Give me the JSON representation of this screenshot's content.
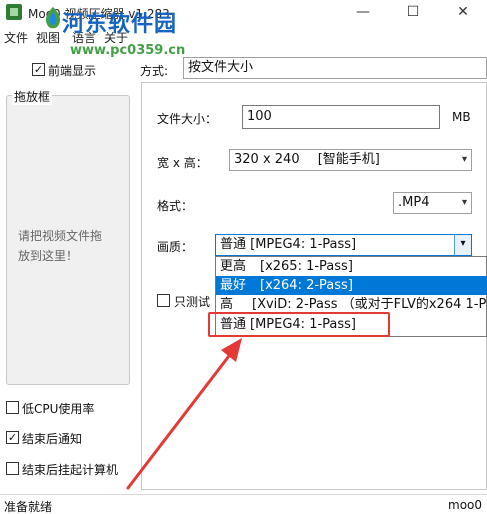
{
  "window": {
    "title": "Moo0 视频压缩器 v1.283",
    "minimize": "—",
    "maximize": "☐",
    "close": "✕"
  },
  "watermark": {
    "site_name": "河东软件园",
    "url": "www.pc0359.cn"
  },
  "menu": [
    "文件",
    "视图",
    "语言",
    "关于"
  ],
  "toolbar": {
    "always_on_top_label": "前端显示",
    "always_on_top_checked": true,
    "mode_label": "方式:",
    "mode_value": "按文件大小"
  },
  "drop_area": {
    "legend": "拖放框",
    "hint_line1": "请把视频文件拖",
    "hint_line2": "放到这里！"
  },
  "options": {
    "low_cpu_label": "低CPU使用率",
    "low_cpu_checked": false,
    "notify_label": "结束后通知",
    "notify_checked": true,
    "shutdown_label": "结束后挂起计算机",
    "shutdown_checked": false
  },
  "settings": {
    "file_size_label": "文件大小：",
    "file_size_value": "100",
    "file_size_unit": "MB",
    "dimension_label": "宽 x 高：",
    "dimension_value": "320 x 240",
    "dimension_tag": "[智能手机]",
    "format_label": "格式：",
    "format_value": ".MP4",
    "quality_label": "画质：",
    "quality_value": "普通  [MPEG4: 1-Pass]",
    "test_only_label": "只测试"
  },
  "quality_options": [
    {
      "name": "更高",
      "codec": "[x265: 1-Pass]"
    },
    {
      "name": "最好",
      "codec": "[x264: 2-Pass]"
    },
    {
      "name": "高",
      "codec": "[XviD: 2-Pass  （或对于FLV的x264 1-P"
    },
    {
      "name": "普通",
      "codec": "[MPEG4: 1-Pass]"
    }
  ],
  "selected_option_index": 1,
  "status": {
    "left": "准备就绪",
    "right": "moo0"
  },
  "colors": {
    "selection": "#0078d7",
    "highlight_box": "#e53935",
    "watermark_title": "#1565c0",
    "watermark_url": "#43a047"
  }
}
